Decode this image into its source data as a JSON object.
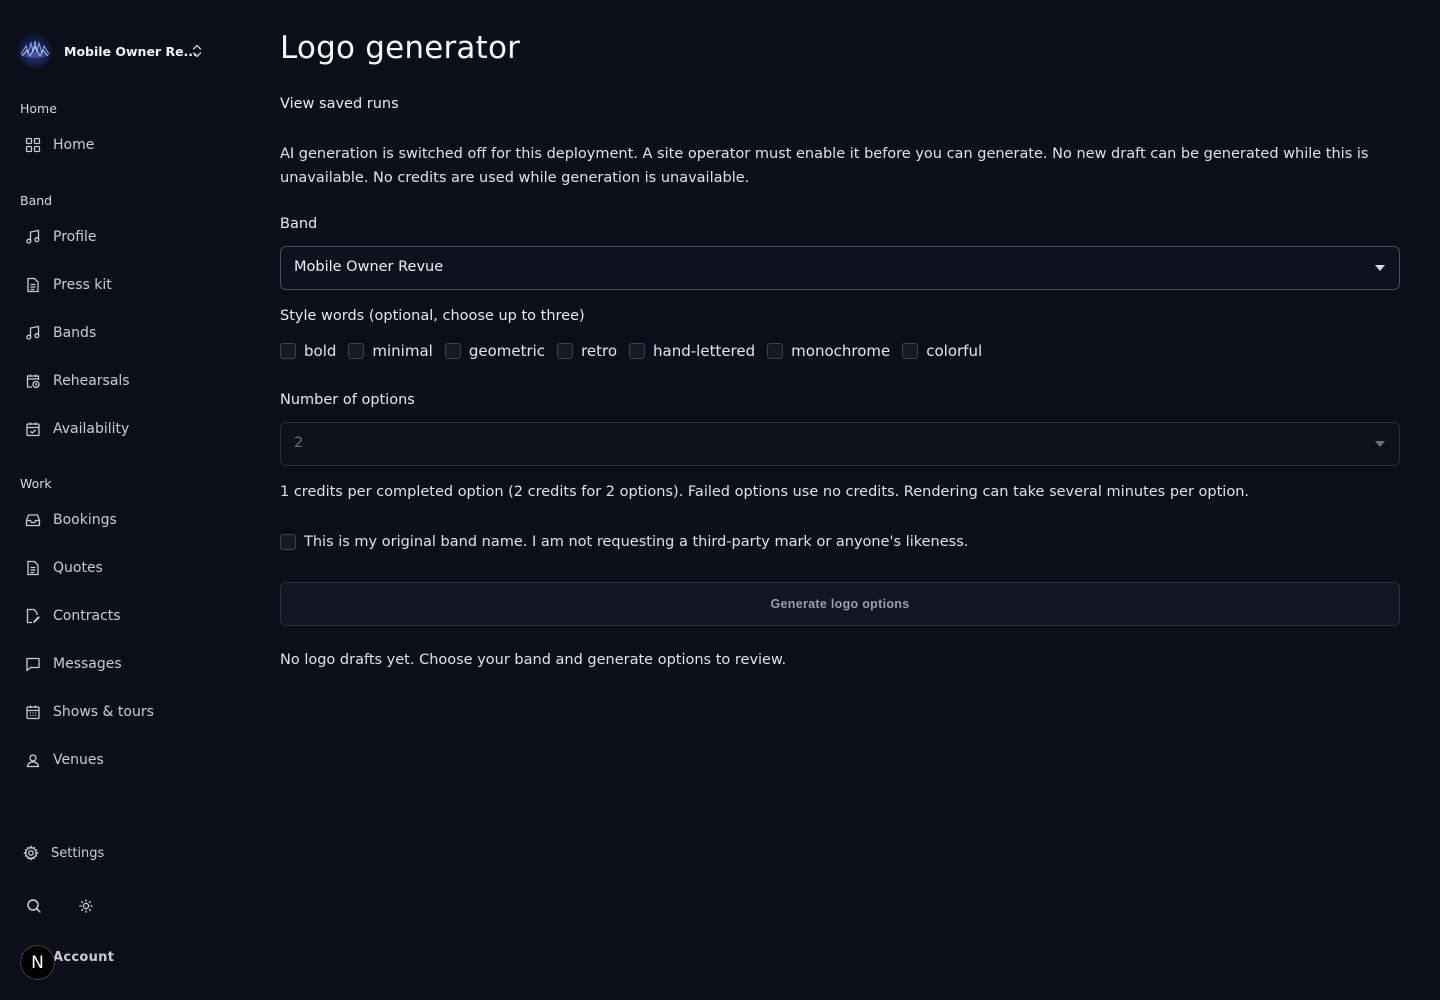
{
  "sidebar": {
    "workspace_name": "Mobile Owner Re...",
    "sections": {
      "home": "Home",
      "band": "Band",
      "work": "Work"
    },
    "items": {
      "home": "Home",
      "profile": "Profile",
      "press_kit": "Press kit",
      "bands": "Bands",
      "rehearsals": "Rehearsals",
      "availability": "Availability",
      "bookings": "Bookings",
      "quotes": "Quotes",
      "contracts": "Contracts",
      "messages": "Messages",
      "shows_tours": "Shows & tours",
      "venues": "Venues"
    },
    "settings": "Settings",
    "account": "Account",
    "avatar_initial": "N"
  },
  "main": {
    "title": "Logo generator",
    "saved_runs_link": "View saved runs",
    "notice": "AI generation is switched off for this deployment. A site operator must enable it before you can generate. No new draft can be generated while this is unavailable. No credits are used while generation is unavailable.",
    "band_label": "Band",
    "band_selected": "Mobile Owner Revue",
    "style_label": "Style words (optional, choose up to three)",
    "style_words": [
      "bold",
      "minimal",
      "geometric",
      "retro",
      "hand-lettered",
      "monochrome",
      "colorful"
    ],
    "options_label": "Number of options",
    "options_selected": "2",
    "credits_text": "1 credits per completed option (2 credits for 2 options). Failed options use no credits. Rendering can take several minutes per option.",
    "consent_text": "This is my original band name. I am not requesting a third-party mark or anyone's likeness.",
    "generate_label": "Generate logo options",
    "empty_state": "No logo drafts yet. Choose your band and generate options to review."
  }
}
